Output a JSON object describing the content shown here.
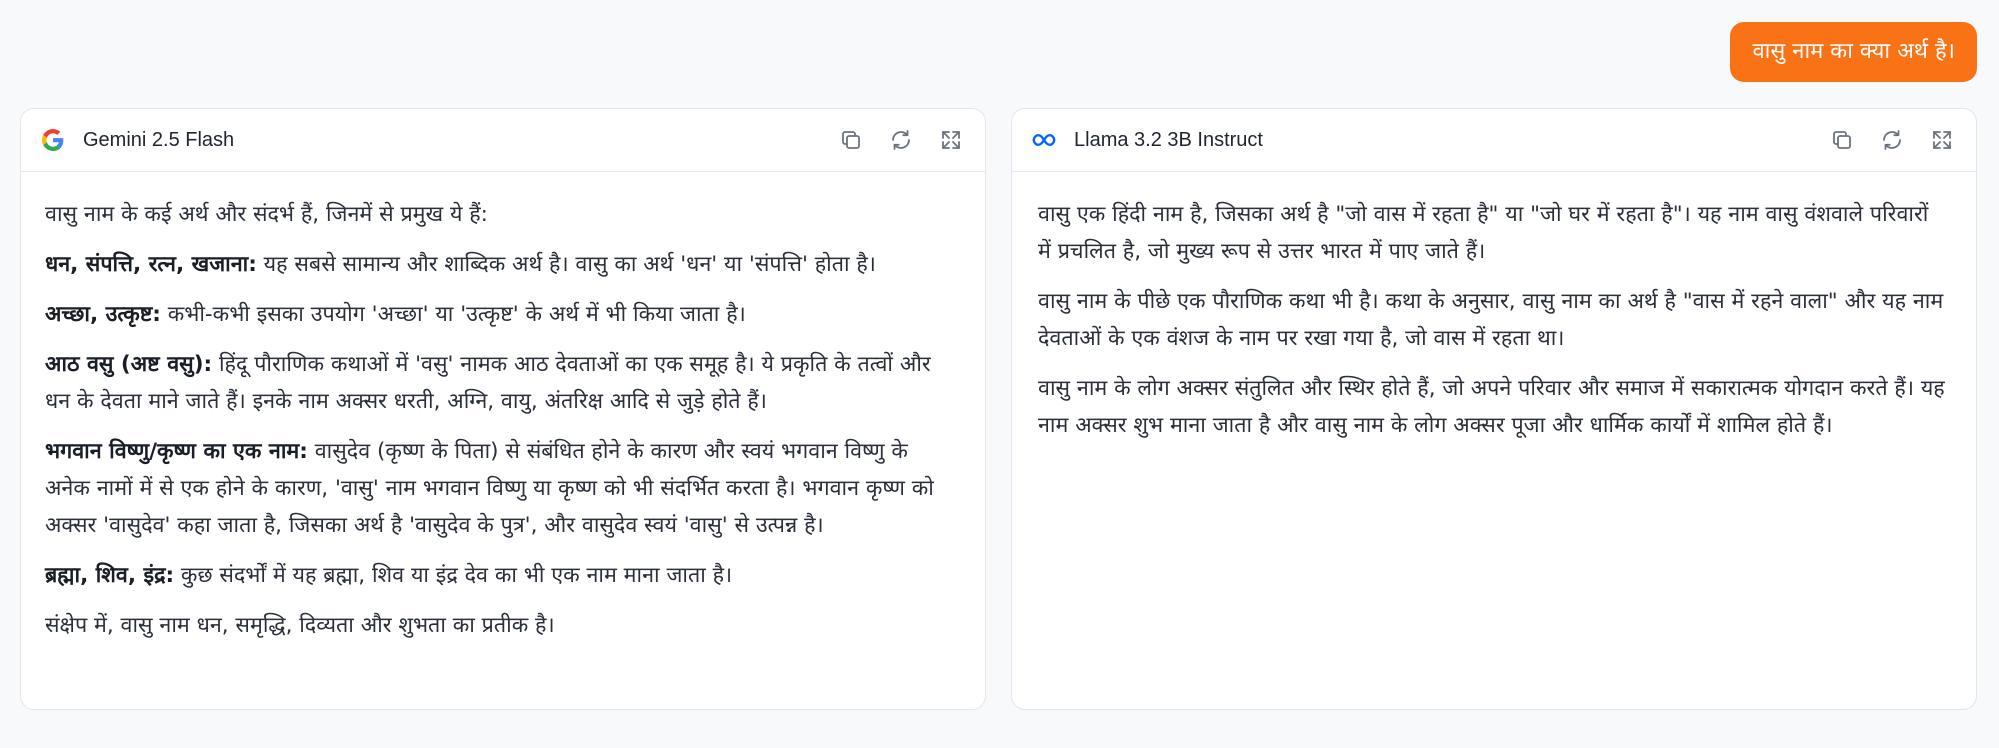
{
  "user_message": "वासु नाम का क्या अर्थ है।",
  "panels": [
    {
      "model": "Gemini 2.5 Flash",
      "logo_icon": "google-g-icon",
      "intro": "वासु नाम के कई अर्थ और संदर्भ हैं, जिनमें से प्रमुख ये हैं:",
      "definitions": [
        {
          "term": "धन, संपत्ति, रत्न, खजाना:",
          "text": " यह सबसे सामान्य और शाब्दिक अर्थ है। वासु का अर्थ 'धन' या 'संपत्ति' होता है।"
        },
        {
          "term": "अच्छा, उत्कृष्ट:",
          "text": " कभी-कभी इसका उपयोग 'अच्छा' या 'उत्कृष्ट' के अर्थ में भी किया जाता है।"
        },
        {
          "term": "आठ वसु (अष्ट वसु):",
          "text": " हिंदू पौराणिक कथाओं में 'वसु' नामक आठ देवताओं का एक समूह है। ये प्रकृति के तत्वों और धन के देवता माने जाते हैं। इनके नाम अक्सर धरती, अग्नि, वायु, अंतरिक्ष आदि से जुड़े होते हैं।"
        },
        {
          "term": "भगवान विष्णु/कृष्ण का एक नाम:",
          "text": " वासुदेव (कृष्ण के पिता) से संबंधित होने के कारण और स्वयं भगवान विष्णु के अनेक नामों में से एक होने के कारण, 'वासु' नाम भगवान विष्णु या कृष्ण को भी संदर्भित करता है। भगवान कृष्ण को अक्सर 'वासुदेव' कहा जाता है, जिसका अर्थ है 'वासुदेव के पुत्र', और वासुदेव स्वयं 'वासु' से उत्पन्न है।"
        },
        {
          "term": "ब्रह्मा, शिव, इंद्र:",
          "text": " कुछ संदर्भों में यह ब्रह्मा, शिव या इंद्र देव का भी एक नाम माना जाता है।"
        }
      ],
      "summary": "संक्षेप में, वासु नाम धन, समृद्धि, दिव्यता और शुभता का प्रतीक है।"
    },
    {
      "model": "Llama 3.2 3B Instruct",
      "logo_icon": "meta-infinity-icon",
      "paragraphs": [
        "वासु एक हिंदी नाम है, जिसका अर्थ है \"जो वास में रहता है\" या \"जो घर में रहता है\"। यह नाम वासु वंशवाले परिवारों में प्रचलित है, जो मुख्य रूप से उत्तर भारत में पाए जाते हैं।",
        "वासु नाम के पीछे एक पौराणिक कथा भी है। कथा के अनुसार, वासु नाम का अर्थ है \"वास में रहने वाला\" और यह नाम देवताओं के एक वंशज के नाम पर रखा गया है, जो वास में रहता था।",
        "वासु नाम के लोग अक्सर संतुलित और स्थिर होते हैं, जो अपने परिवार और समाज में सकारात्मक योगदान करते हैं। यह नाम अक्सर शुभ माना जाता है और वासु नाम के लोग अक्सर पूजा और धार्मिक कार्यों में शामिल होते हैं।"
      ]
    }
  ],
  "actions": [
    "copy-icon",
    "refresh-icon",
    "expand-icon"
  ],
  "colors": {
    "accent": "#f97316",
    "meta_blue": "#0866ff"
  }
}
